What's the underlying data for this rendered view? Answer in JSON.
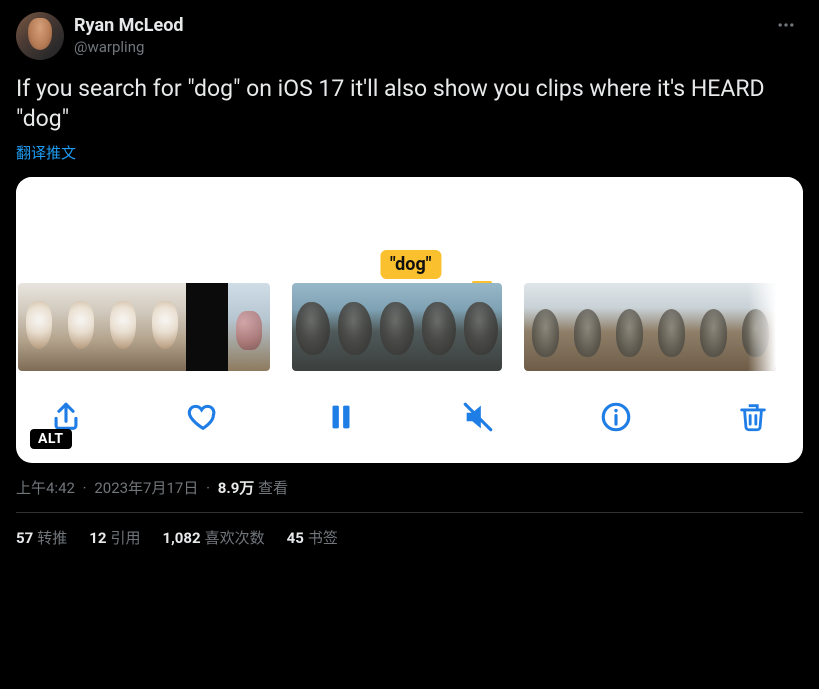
{
  "author": {
    "display_name": "Ryan McLeod",
    "handle": "@warpling"
  },
  "tweet_text": "If you search for \"dog\" on iOS 17 it'll also show you clips where it's HEARD \"dog\"",
  "translate_label": "翻译推文",
  "media": {
    "search_tag": "\"dog\"",
    "alt_label": "ALT",
    "toolbar_icons": [
      "share",
      "heart",
      "pause",
      "mute",
      "info",
      "trash"
    ]
  },
  "meta": {
    "time": "上午4:42",
    "date": "2023年7月17日",
    "views_value": "8.9万",
    "views_label": "查看"
  },
  "stats": {
    "retweets": {
      "count": "57",
      "label": "转推"
    },
    "quotes": {
      "count": "12",
      "label": "引用"
    },
    "likes": {
      "count": "1,082",
      "label": "喜欢次数"
    },
    "bookmarks": {
      "count": "45",
      "label": "书签"
    }
  }
}
